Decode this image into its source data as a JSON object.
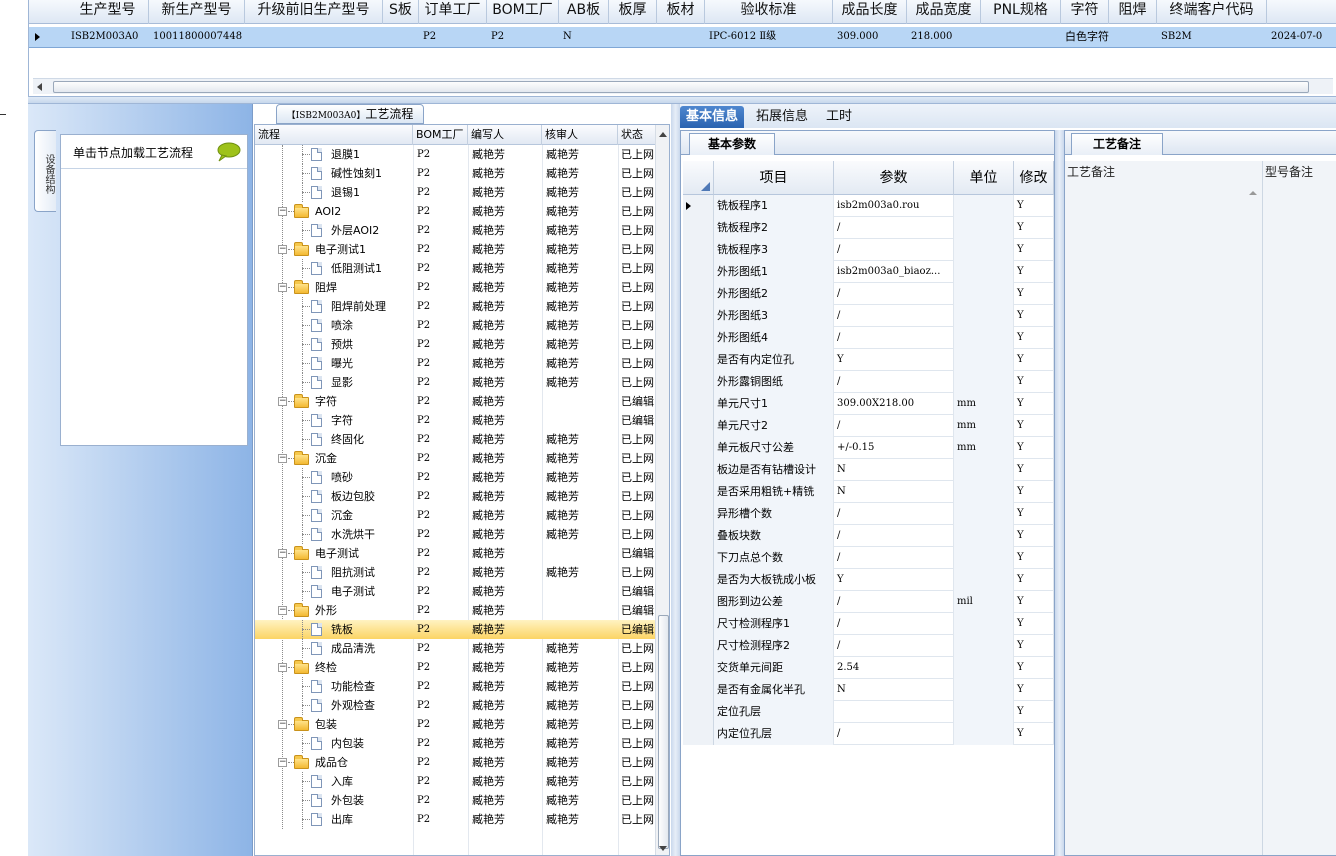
{
  "top_grid": {
    "headers": [
      "生产型号",
      "新生产型号",
      "升级前旧生产型号",
      "S板",
      "订单工厂",
      "BOM工厂",
      "AB板",
      "板厚",
      "板材",
      "验收标准",
      "成品长度",
      "成品宽度",
      "PNL规格",
      "字符",
      "阻焊",
      "终端客户代码"
    ],
    "row": [
      "ISB2M003A0",
      "10011800007448",
      "",
      "",
      "P2",
      "P2",
      "N",
      "",
      "",
      "IPC-6012 Ⅱ级",
      "309.000",
      "218.000",
      "",
      "白色字符",
      "",
      "SB2M",
      "2024-07-0"
    ]
  },
  "left_panel": {
    "vertical_tab": "设备结构",
    "hint": "单击节点加载工艺流程"
  },
  "flow_tab": {
    "model": "【ISB2M003A0】",
    "label": "工艺流程"
  },
  "tree": {
    "headers": [
      "流程",
      "BOM工厂",
      "编写人",
      "核审人",
      "状态"
    ],
    "rows": [
      {
        "name": "退膜1",
        "level": 1,
        "bom": "P2",
        "writer": "臧艳芳",
        "reviewer": "臧艳芳",
        "status": "已上网"
      },
      {
        "name": "碱性蚀刻1",
        "level": 1,
        "bom": "P2",
        "writer": "臧艳芳",
        "reviewer": "臧艳芳",
        "status": "已上网"
      },
      {
        "name": "退锡1",
        "level": 1,
        "bom": "P2",
        "writer": "臧艳芳",
        "reviewer": "臧艳芳",
        "status": "已上网"
      },
      {
        "name": "AOI2",
        "level": 0,
        "bom": "P2",
        "writer": "臧艳芳",
        "reviewer": "臧艳芳",
        "status": "已上网"
      },
      {
        "name": "外层AOI2",
        "level": 1,
        "bom": "P2",
        "writer": "臧艳芳",
        "reviewer": "臧艳芳",
        "status": "已上网"
      },
      {
        "name": "电子测试1",
        "level": 0,
        "bom": "P2",
        "writer": "臧艳芳",
        "reviewer": "臧艳芳",
        "status": "已上网"
      },
      {
        "name": "低阻测试1",
        "level": 1,
        "bom": "P2",
        "writer": "臧艳芳",
        "reviewer": "臧艳芳",
        "status": "已上网"
      },
      {
        "name": "阻焊",
        "level": 0,
        "bom": "P2",
        "writer": "臧艳芳",
        "reviewer": "臧艳芳",
        "status": "已上网"
      },
      {
        "name": "阻焊前处理",
        "level": 1,
        "bom": "P2",
        "writer": "臧艳芳",
        "reviewer": "臧艳芳",
        "status": "已上网"
      },
      {
        "name": "喷涂",
        "level": 1,
        "bom": "P2",
        "writer": "臧艳芳",
        "reviewer": "臧艳芳",
        "status": "已上网"
      },
      {
        "name": "预烘",
        "level": 1,
        "bom": "P2",
        "writer": "臧艳芳",
        "reviewer": "臧艳芳",
        "status": "已上网"
      },
      {
        "name": "曝光",
        "level": 1,
        "bom": "P2",
        "writer": "臧艳芳",
        "reviewer": "臧艳芳",
        "status": "已上网"
      },
      {
        "name": "显影",
        "level": 1,
        "bom": "P2",
        "writer": "臧艳芳",
        "reviewer": "臧艳芳",
        "status": "已上网"
      },
      {
        "name": "字符",
        "level": 0,
        "bom": "P2",
        "writer": "臧艳芳",
        "reviewer": "",
        "status": "已编辑"
      },
      {
        "name": "字符",
        "level": 1,
        "bom": "P2",
        "writer": "臧艳芳",
        "reviewer": "",
        "status": "已编辑"
      },
      {
        "name": "终固化",
        "level": 1,
        "bom": "P2",
        "writer": "臧艳芳",
        "reviewer": "臧艳芳",
        "status": "已上网"
      },
      {
        "name": "沉金",
        "level": 0,
        "bom": "P2",
        "writer": "臧艳芳",
        "reviewer": "臧艳芳",
        "status": "已上网"
      },
      {
        "name": "喷砂",
        "level": 1,
        "bom": "P2",
        "writer": "臧艳芳",
        "reviewer": "臧艳芳",
        "status": "已上网"
      },
      {
        "name": "板边包胶",
        "level": 1,
        "bom": "P2",
        "writer": "臧艳芳",
        "reviewer": "臧艳芳",
        "status": "已上网"
      },
      {
        "name": "沉金",
        "level": 1,
        "bom": "P2",
        "writer": "臧艳芳",
        "reviewer": "臧艳芳",
        "status": "已上网"
      },
      {
        "name": "水洗烘干",
        "level": 1,
        "bom": "P2",
        "writer": "臧艳芳",
        "reviewer": "臧艳芳",
        "status": "已上网"
      },
      {
        "name": "电子测试",
        "level": 0,
        "bom": "P2",
        "writer": "臧艳芳",
        "reviewer": "",
        "status": "已编辑"
      },
      {
        "name": "阻抗测试",
        "level": 1,
        "bom": "P2",
        "writer": "臧艳芳",
        "reviewer": "臧艳芳",
        "status": "已上网"
      },
      {
        "name": "电子测试",
        "level": 1,
        "bom": "P2",
        "writer": "臧艳芳",
        "reviewer": "",
        "status": "已编辑"
      },
      {
        "name": "外形",
        "level": 0,
        "bom": "P2",
        "writer": "臧艳芳",
        "reviewer": "",
        "status": "已编辑"
      },
      {
        "name": "铣板",
        "level": 1,
        "bom": "P2",
        "writer": "臧艳芳",
        "reviewer": "",
        "status": "已编辑",
        "selected": true
      },
      {
        "name": "成品清洗",
        "level": 1,
        "bom": "P2",
        "writer": "臧艳芳",
        "reviewer": "臧艳芳",
        "status": "已上网"
      },
      {
        "name": "终检",
        "level": 0,
        "bom": "P2",
        "writer": "臧艳芳",
        "reviewer": "臧艳芳",
        "status": "已上网"
      },
      {
        "name": "功能检查",
        "level": 1,
        "bom": "P2",
        "writer": "臧艳芳",
        "reviewer": "臧艳芳",
        "status": "已上网"
      },
      {
        "name": "外观检查",
        "level": 1,
        "bom": "P2",
        "writer": "臧艳芳",
        "reviewer": "臧艳芳",
        "status": "已上网"
      },
      {
        "name": "包装",
        "level": 0,
        "bom": "P2",
        "writer": "臧艳芳",
        "reviewer": "臧艳芳",
        "status": "已上网"
      },
      {
        "name": "内包装",
        "level": 1,
        "bom": "P2",
        "writer": "臧艳芳",
        "reviewer": "臧艳芳",
        "status": "已上网"
      },
      {
        "name": "成品仓",
        "level": 0,
        "bom": "P2",
        "writer": "臧艳芳",
        "reviewer": "臧艳芳",
        "status": "已上网"
      },
      {
        "name": "入库",
        "level": 1,
        "bom": "P2",
        "writer": "臧艳芳",
        "reviewer": "臧艳芳",
        "status": "已上网"
      },
      {
        "name": "外包装",
        "level": 1,
        "bom": "P2",
        "writer": "臧艳芳",
        "reviewer": "臧艳芳",
        "status": "已上网"
      },
      {
        "name": "出库",
        "level": 1,
        "bom": "P2",
        "writer": "臧艳芳",
        "reviewer": "臧艳芳",
        "status": "已上网"
      }
    ]
  },
  "right_tabs": [
    "基本信息",
    "拓展信息",
    "工时"
  ],
  "basic_params": {
    "tab": "基本参数",
    "headers": [
      "项目",
      "参数",
      "单位",
      "修改"
    ],
    "rows": [
      [
        "铣板程序1",
        "isb2m003a0.rou",
        "",
        "Y"
      ],
      [
        "铣板程序2",
        "/",
        "",
        "Y"
      ],
      [
        "铣板程序3",
        "/",
        "",
        "Y"
      ],
      [
        "外形图纸1",
        "isb2m003a0_biaoz...",
        "",
        "Y"
      ],
      [
        "外形图纸2",
        "/",
        "",
        "Y"
      ],
      [
        "外形图纸3",
        "/",
        "",
        "Y"
      ],
      [
        "外形图纸4",
        "/",
        "",
        "Y"
      ],
      [
        "是否有内定位孔",
        "Y",
        "",
        "Y"
      ],
      [
        "外形露铜图纸",
        "/",
        "",
        "Y"
      ],
      [
        "单元尺寸1",
        "309.00X218.00",
        "mm",
        "Y"
      ],
      [
        "单元尺寸2",
        "/",
        "mm",
        "Y"
      ],
      [
        "单元板尺寸公差",
        "+/-0.15",
        "mm",
        "Y"
      ],
      [
        "板边是否有钻槽设计",
        "N",
        "",
        "Y"
      ],
      [
        "是否采用粗铣+精铣",
        "N",
        "",
        "Y"
      ],
      [
        "异形槽个数",
        "/",
        "",
        "Y"
      ],
      [
        "叠板块数",
        "/",
        "",
        "Y"
      ],
      [
        "下刀点总个数",
        "/",
        "",
        "Y"
      ],
      [
        "是否为大板铣成小板",
        "Y",
        "",
        "Y"
      ],
      [
        "图形到边公差",
        "/",
        "mil",
        "Y"
      ],
      [
        "尺寸检测程序1",
        "/",
        "",
        "Y"
      ],
      [
        "尺寸检测程序2",
        "/",
        "",
        "Y"
      ],
      [
        "交货单元间距",
        "2.54",
        "",
        "Y"
      ],
      [
        "是否有金属化半孔",
        "N",
        "",
        "Y"
      ],
      [
        "定位孔层",
        "",
        "",
        "Y"
      ],
      [
        "内定位孔层",
        "/",
        "",
        "Y"
      ]
    ]
  },
  "remarks": {
    "tab": "工艺备注",
    "col1": "工艺备注",
    "col2": "型号备注"
  },
  "colors": {
    "accent": "#2a63b0",
    "selection": "#b8d6f5",
    "tree_selected": "#fbd465"
  }
}
